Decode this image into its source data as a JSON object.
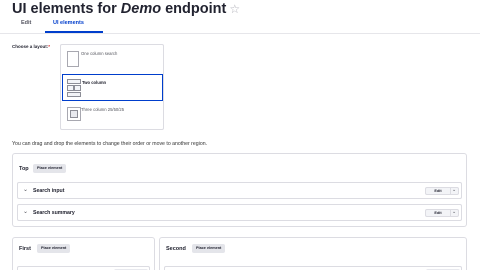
{
  "page": {
    "title_prefix": "UI elements for ",
    "title_em": "Demo",
    "title_suffix": " endpoint",
    "star": "☆"
  },
  "tabs": [
    {
      "label": "Edit",
      "active": false
    },
    {
      "label": "UI elements",
      "active": true
    }
  ],
  "layout": {
    "label": "Choose a layout:",
    "required_mark": "*",
    "options": [
      {
        "label": "One column search",
        "selected": false
      },
      {
        "label": "Two column",
        "selected": true
      },
      {
        "label": "Three column 25/50/25",
        "selected": false
      }
    ]
  },
  "help_text": "You can drag and drop the elements to change their order or move to another region.",
  "regions": {
    "top": {
      "title": "Top",
      "place_label": "Place element",
      "blocks": [
        {
          "label": "Search input",
          "edit_label": "Edit"
        },
        {
          "label": "Search summary",
          "edit_label": "Edit"
        }
      ]
    },
    "first": {
      "title": "First",
      "place_label": "Place element"
    },
    "second": {
      "title": "Second",
      "place_label": "Place element"
    }
  },
  "icons": {
    "chevron": "chevron-down-icon",
    "caret": "caret-down-icon",
    "star": "star-outline-icon"
  },
  "colors": {
    "accent": "#003ecc",
    "required": "#d72222",
    "button_bg": "#e4e5ea"
  }
}
